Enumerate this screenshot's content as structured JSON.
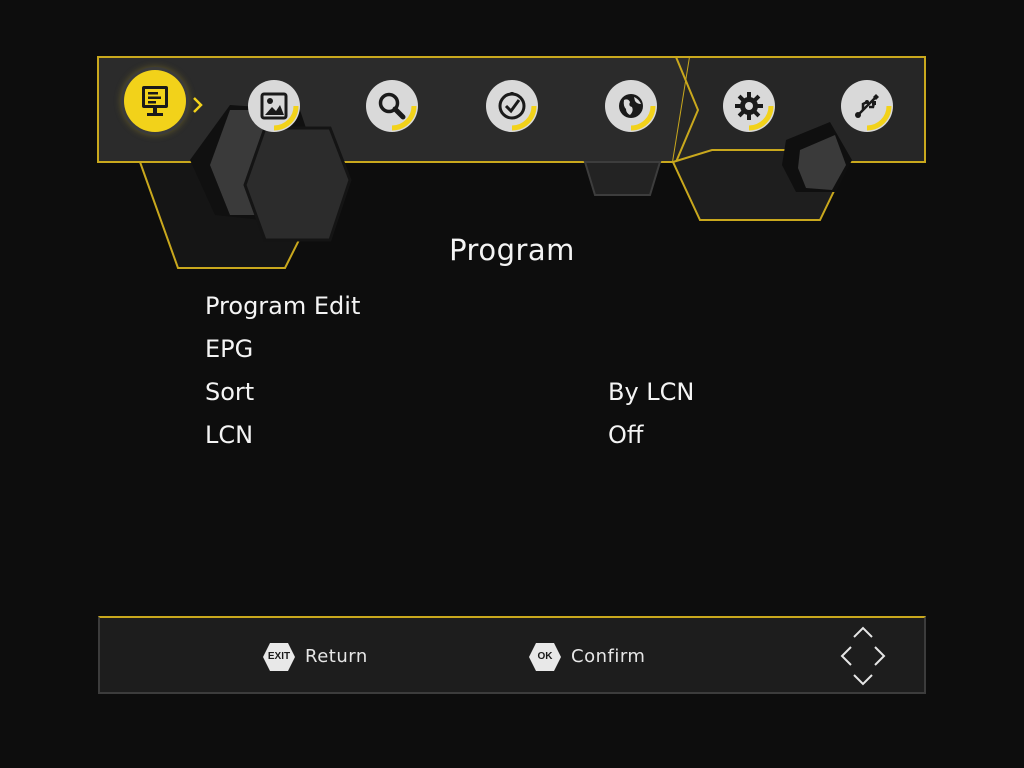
{
  "menu_bar": {
    "tabs": [
      {
        "id": "program",
        "icon": "tv-list-icon",
        "active": true
      },
      {
        "id": "picture",
        "icon": "picture-icon",
        "active": false
      },
      {
        "id": "search",
        "icon": "search-icon",
        "active": false
      },
      {
        "id": "time",
        "icon": "clock-icon",
        "active": false
      },
      {
        "id": "option",
        "icon": "globe-icon",
        "active": false
      },
      {
        "id": "system",
        "icon": "gear-icon",
        "active": false
      },
      {
        "id": "usb",
        "icon": "usb-icon",
        "active": false
      }
    ]
  },
  "page": {
    "title": "Program"
  },
  "menu": {
    "items": [
      {
        "label": "Program Edit",
        "value": ""
      },
      {
        "label": "EPG",
        "value": ""
      },
      {
        "label": "Sort",
        "value": "By LCN"
      },
      {
        "label": "LCN",
        "value": "Off"
      }
    ]
  },
  "footer": {
    "exit_key": "EXIT",
    "exit_label": "Return",
    "ok_key": "OK",
    "ok_label": "Confirm",
    "navigate_icon": "dpad-arrows-icon"
  },
  "colors": {
    "accent": "#f2d21a",
    "gold_line": "#c9a81d",
    "background": "#0d0d0d",
    "panel": "#2a2a2a",
    "text": "#f4f4f4"
  }
}
